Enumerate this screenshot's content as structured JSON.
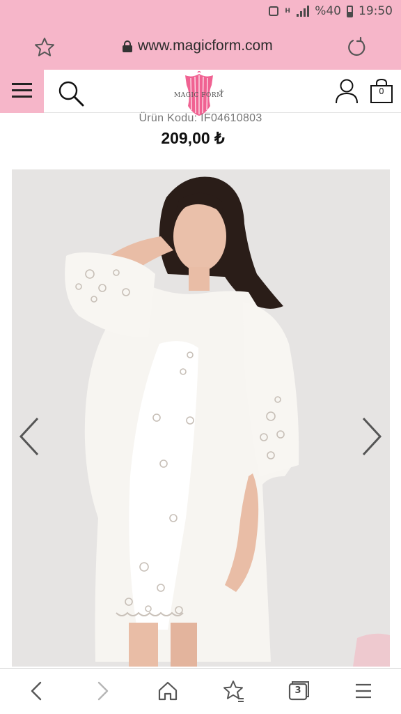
{
  "status_bar": {
    "signal_label": "H",
    "battery_text": "%40",
    "time": "19:50"
  },
  "browser": {
    "url": "www.magicform.com",
    "tabs_count": "3"
  },
  "site": {
    "logo_text": "MAGIC FORM",
    "cart_count": "0"
  },
  "product": {
    "code": "Ürün Kodu: IF04610803",
    "price": "209,00 ₺"
  },
  "icons": {
    "favorite": "star-icon",
    "lock": "lock-icon",
    "reload": "reload-icon",
    "menu": "hamburger-icon",
    "search": "search-icon",
    "account": "user-icon",
    "cart": "shopping-bag-icon",
    "back": "chevron-left-icon",
    "forward": "chevron-right-icon",
    "home": "home-icon",
    "bookmarks": "bookmark-star-icon",
    "tabs": "tabs-icon",
    "browser_menu": "hamburger-icon"
  },
  "colors": {
    "brand_pink": "#f6b6c9",
    "logo_pink": "#f06292",
    "photo_background": "#e6e4e3"
  }
}
